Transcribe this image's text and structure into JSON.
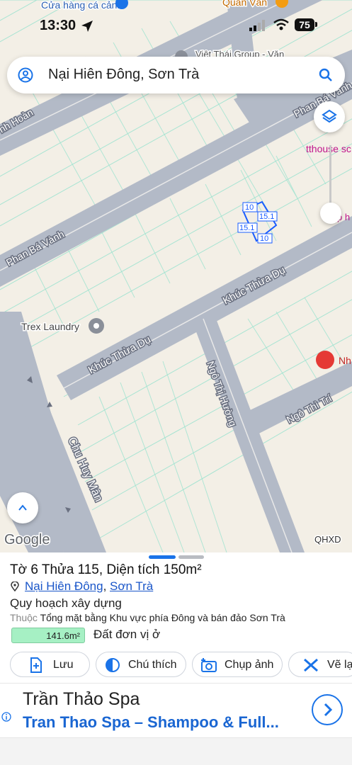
{
  "status": {
    "time": "13:30",
    "battery": "75"
  },
  "search": {
    "query": "Nại Hiên Đông, Sơn Trà"
  },
  "map": {
    "pois": {
      "store_top": "Cửa hàng cá cảnh",
      "quan_van": "Quán Văn",
      "viet_thai": "Việt Thái Group - Văn",
      "tthouse": "tthouse sc",
      "trex": "Trex Laundry",
      "nh": "Nh",
      "right_p": "p h"
    },
    "roads": {
      "hoan": "nh Hoàn",
      "phan_ba_vanh": "Phan Bá Vành",
      "phan_ba_vanh_top": "Phan Bá Vành",
      "khuc_thua_du_1": "Khúc Thừa Dụ",
      "khuc_thua_du_2": "Khúc Thừa Dụ",
      "ngo_thi_huong": "Ngô Thị Hường",
      "ngo_thi_tri": "Ngô Thì Trí",
      "chu_huy_man": "Chu Huy Mân"
    },
    "parcel_dims": {
      "top": "10",
      "right": "15.1",
      "left": "15.1",
      "bottom": "10"
    },
    "attribution": {
      "google": "Google",
      "qhxd": "QHXD"
    }
  },
  "sheet": {
    "title": "Tờ 6 Thửa 115, Diện tích 150m²",
    "address_ward": "Nại Hiên Đông",
    "address_sep": ", ",
    "address_district": "Sơn Trà",
    "plan_label": "Quy hoạch xây dựng",
    "belongs_prefix": "Thuộc",
    "belongs_text": "Tổng mặt bằng Khu vực phía Đông và bán đảo Sơn Trà",
    "area_value": "141.6m²",
    "land_use": "Đất đơn vị ở",
    "actions": [
      {
        "label": "Lưu",
        "icon": "add-note-icon"
      },
      {
        "label": "Chú thích",
        "icon": "half-circle-icon"
      },
      {
        "label": "Chụp ảnh",
        "icon": "camera-plus-icon"
      },
      {
        "label": "Vẽ lạ",
        "icon": "ruler-cross-icon"
      }
    ]
  },
  "ad": {
    "title": "Trần Thảo Spa",
    "subtitle": "Tran Thao Spa – Shampoo & Full..."
  },
  "colors": {
    "accent": "#1a73e8",
    "ad_link": "#1a66d2",
    "area_chip": "#a6f0c4",
    "road": "#b3bac7",
    "land": "#f3efe6",
    "parcel_line": "#9fe3d0"
  }
}
